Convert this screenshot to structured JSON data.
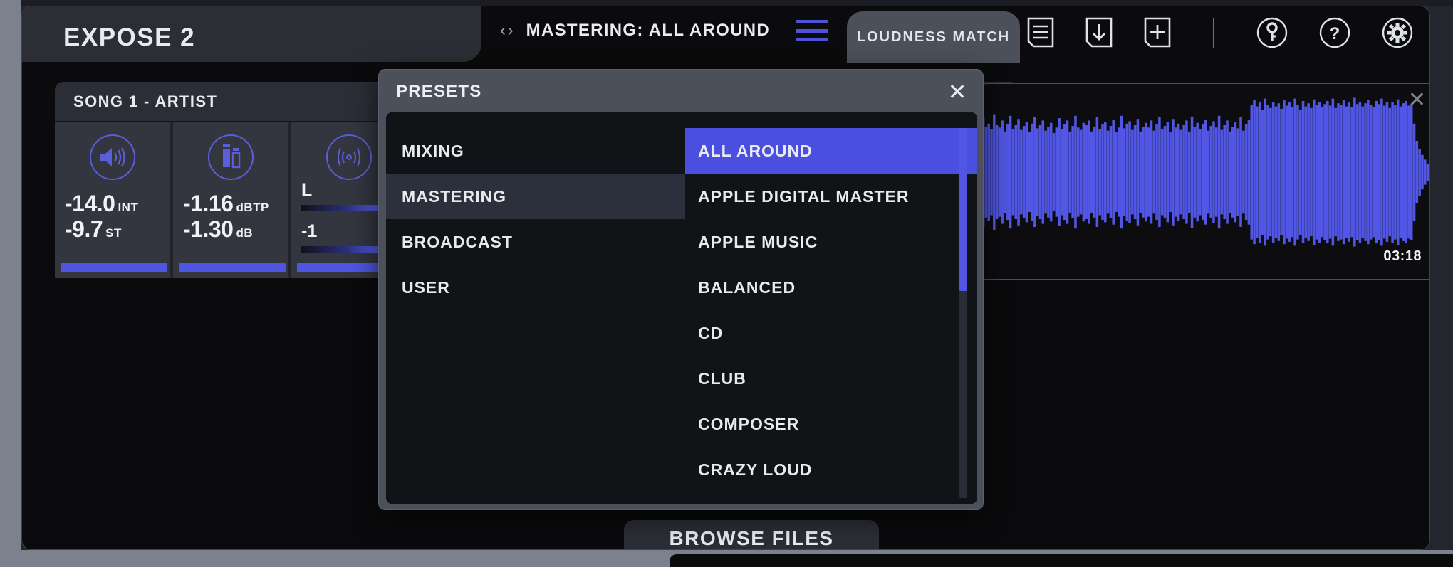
{
  "app": {
    "title": "EXPOSE 2"
  },
  "topbar": {
    "preset_nav_arrows": "‹ ›",
    "current_preset": "MASTERING: ALL AROUND",
    "menu_icon": "hamburger-icon",
    "tab_label": "LOUDNESS MATCH",
    "icons": [
      {
        "name": "document-list-icon",
        "label": "Report"
      },
      {
        "name": "import-download-icon",
        "label": "Import"
      },
      {
        "name": "add-file-icon",
        "label": "Add"
      },
      {
        "name": "key-icon",
        "label": "License"
      },
      {
        "name": "help-icon",
        "label": "Help"
      },
      {
        "name": "gear-icon",
        "label": "Settings"
      }
    ]
  },
  "song": {
    "title": "SONG 1 - ARTIST",
    "meters": [
      {
        "icon": "loudness-speaker-icon",
        "value1": "-14.0",
        "unit1": "INT",
        "value2": "-9.7",
        "unit2": "ST"
      },
      {
        "icon": "peak-bars-icon",
        "value1": "-1.16",
        "unit1": "dBTP",
        "value2": "-1.30",
        "unit2": "dB"
      },
      {
        "icon": "stereo-field-icon",
        "value1": "L",
        "unit1": "",
        "value2": "-1",
        "unit2": ""
      }
    ]
  },
  "waveform": {
    "duration": "03:18",
    "close_label": "✕",
    "color": "#5157e4",
    "peaks": [
      0.52,
      0.7,
      0.58,
      0.62,
      0.55,
      0.74,
      0.6,
      0.57,
      0.66,
      0.52,
      0.61,
      0.72,
      0.55,
      0.6,
      0.68,
      0.54,
      0.59,
      0.64,
      0.51,
      0.62,
      0.7,
      0.56,
      0.6,
      0.66,
      0.53,
      0.58,
      0.63,
      0.5,
      0.57,
      0.69,
      0.55,
      0.61,
      0.66,
      0.52,
      0.59,
      0.72,
      0.57,
      0.54,
      0.63,
      0.6,
      0.66,
      0.52,
      0.58,
      0.7,
      0.55,
      0.61,
      0.64,
      0.53,
      0.59,
      0.67,
      0.51,
      0.57,
      0.72,
      0.56,
      0.62,
      0.65,
      0.54,
      0.6,
      0.68,
      0.52,
      0.58,
      0.63,
      0.57,
      0.66,
      0.53,
      0.61,
      0.7,
      0.55,
      0.59,
      0.64,
      0.51,
      0.68,
      0.57,
      0.62,
      0.54,
      0.6,
      0.66,
      0.52,
      0.71,
      0.58,
      0.63,
      0.55,
      0.61,
      0.67,
      0.53,
      0.59,
      0.65,
      0.57,
      0.72,
      0.54,
      0.6,
      0.66,
      0.52,
      0.58,
      0.64,
      0.56,
      0.7,
      0.53,
      0.61,
      0.67,
      0.86,
      0.92,
      0.84,
      0.9,
      0.8,
      0.94,
      0.86,
      0.82,
      0.9,
      0.84,
      0.88,
      0.81,
      0.92,
      0.85,
      0.89,
      0.83,
      0.94,
      0.86,
      0.8,
      0.91,
      0.84,
      0.88,
      0.82,
      0.93,
      0.86,
      0.9,
      0.83,
      0.87,
      0.91,
      0.85,
      0.94,
      0.82,
      0.88,
      0.86,
      0.92,
      0.84,
      0.89,
      0.83,
      0.95,
      0.87,
      0.9,
      0.84,
      0.88,
      0.92,
      0.86,
      0.83,
      0.91,
      0.87,
      0.94,
      0.85,
      0.89,
      0.82,
      0.9,
      0.86,
      0.93,
      0.84,
      0.88,
      0.91,
      0.85,
      0.87,
      0.62,
      0.4,
      0.3,
      0.22,
      0.16,
      0.11,
      0.07,
      0.05,
      0.03
    ]
  },
  "dialog": {
    "title": "PRESETS",
    "close_label": "✕",
    "categories": [
      {
        "label": "MIXING",
        "active": false
      },
      {
        "label": "MASTERING",
        "active": true
      },
      {
        "label": "BROADCAST",
        "active": false
      },
      {
        "label": "USER",
        "active": false
      }
    ],
    "presets": [
      {
        "label": "ALL AROUND",
        "selected": true
      },
      {
        "label": "APPLE DIGITAL MASTER",
        "selected": false
      },
      {
        "label": "APPLE MUSIC",
        "selected": false
      },
      {
        "label": "BALANCED",
        "selected": false
      },
      {
        "label": "CD",
        "selected": false
      },
      {
        "label": "CLUB",
        "selected": false
      },
      {
        "label": "COMPOSER",
        "selected": false
      },
      {
        "label": "CRAZY LOUD",
        "selected": false
      }
    ]
  },
  "footer": {
    "browse_label": "BROWSE FILES"
  },
  "colors": {
    "accent": "#4a4fe0",
    "panel": "#2b2e36",
    "background": "#0b0b0d"
  }
}
